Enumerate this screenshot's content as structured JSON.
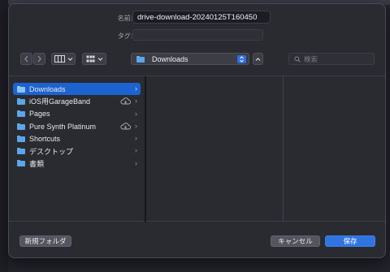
{
  "dialog": {
    "name_label": "名前:",
    "name_value": "drive-download-20240125T160450",
    "tags_label": "タグ:",
    "tags_value": ""
  },
  "toolbar": {
    "back_icon": "chevron-left-icon",
    "forward_icon": "chevron-right-icon",
    "view_mode_icon": "columns-view-icon",
    "group_icon": "grid-view-icon",
    "location": "Downloads",
    "expand_icon": "chevron-up-icon",
    "search_placeholder": "検索"
  },
  "sidebar": {
    "items": [
      {
        "label": "Downloads",
        "icon": "folder-icon",
        "selected": true,
        "cloud": false
      },
      {
        "label": "iOS用GarageBand",
        "icon": "folder-icon",
        "selected": false,
        "cloud": true
      },
      {
        "label": "Pages",
        "icon": "folder-icon",
        "selected": false,
        "cloud": false
      },
      {
        "label": "Pure Synth Platinum",
        "icon": "folder-icon",
        "selected": false,
        "cloud": true
      },
      {
        "label": "Shortcuts",
        "icon": "folder-icon",
        "selected": false,
        "cloud": false
      },
      {
        "label": "デスクトップ",
        "icon": "folder-icon",
        "selected": false,
        "cloud": false
      },
      {
        "label": "書類",
        "icon": "folder-icon",
        "selected": false,
        "cloud": false
      }
    ]
  },
  "footer": {
    "new_folder_label": "新規フォルダ",
    "cancel_label": "キャンセル",
    "save_label": "保存"
  },
  "colors": {
    "accent": "#2f74e0",
    "selection": "#1d63cf",
    "sheet_bg": "#2a2a31",
    "folder": "#59a6ea"
  }
}
